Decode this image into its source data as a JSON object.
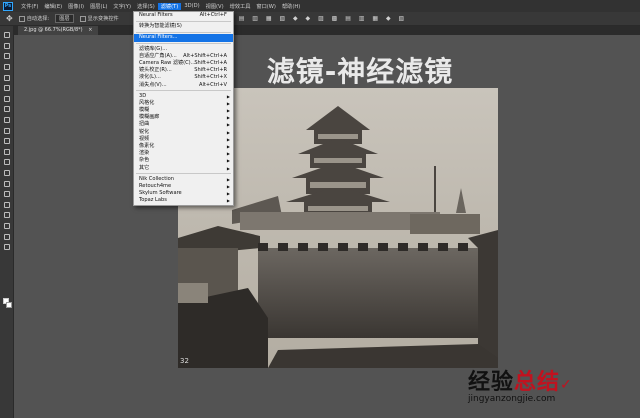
{
  "menubar": {
    "logo": "Ps",
    "items": [
      "文件(F)",
      "编辑(E)",
      "图像(I)",
      "图层(L)",
      "文字(Y)",
      "选择(S)",
      "滤镜(T)",
      "3D(D)",
      "视图(V)",
      "增效工具",
      "窗口(W)",
      "帮助(H)"
    ],
    "active_index": 6
  },
  "options_bar": {
    "auto_select_label": "自动选择:",
    "layer_select": "图层",
    "show_transform_label": "显示变换控件"
  },
  "document_tab": {
    "label": "2.jpg @ 66.7%(RGB/8*)"
  },
  "canvas": {
    "title": "滤镜-神经滤镜",
    "photo_number": "32",
    "watermark_title_1": "经验",
    "watermark_title_2": "总结",
    "watermark_url": "jingyanzongjie.com"
  },
  "filter_menu": {
    "items": [
      {
        "label": "Neural Filters",
        "shortcut": "Alt+Ctrl+F",
        "type": "item"
      },
      {
        "type": "sep"
      },
      {
        "label": "转换为智能滤镜(S)",
        "shortcut": "",
        "type": "item"
      },
      {
        "type": "sep"
      },
      {
        "label": "Neural Filters...",
        "shortcut": "",
        "type": "item",
        "highlight": true
      },
      {
        "type": "sep"
      },
      {
        "label": "滤镜库(G)...",
        "shortcut": "",
        "type": "item"
      },
      {
        "label": "自适应广角(A)...",
        "shortcut": "Alt+Shift+Ctrl+A",
        "type": "item"
      },
      {
        "label": "Camera Raw 滤镜(C)...",
        "shortcut": "Shift+Ctrl+A",
        "type": "item"
      },
      {
        "label": "镜头校正(R)...",
        "shortcut": "Shift+Ctrl+R",
        "type": "item"
      },
      {
        "label": "液化(L)...",
        "shortcut": "Shift+Ctrl+X",
        "type": "item"
      },
      {
        "label": "消失点(V)...",
        "shortcut": "Alt+Ctrl+V",
        "type": "item"
      },
      {
        "type": "sep"
      },
      {
        "label": "3D",
        "type": "sub"
      },
      {
        "label": "风格化",
        "type": "sub"
      },
      {
        "label": "模糊",
        "type": "sub"
      },
      {
        "label": "模糊画廊",
        "type": "sub"
      },
      {
        "label": "扭曲",
        "type": "sub"
      },
      {
        "label": "锐化",
        "type": "sub"
      },
      {
        "label": "视频",
        "type": "sub"
      },
      {
        "label": "像素化",
        "type": "sub"
      },
      {
        "label": "渲染",
        "type": "sub"
      },
      {
        "label": "杂色",
        "type": "sub"
      },
      {
        "label": "其它",
        "type": "sub"
      },
      {
        "type": "sep"
      },
      {
        "label": "Nik Collection",
        "type": "sub"
      },
      {
        "label": "Retouch4me",
        "type": "sub"
      },
      {
        "label": "Skylum Software",
        "type": "sub"
      },
      {
        "label": "Topaz Labs",
        "type": "sub"
      }
    ]
  },
  "colors": {
    "accent": "#1473e6",
    "workspace": "#535353",
    "menubar": "#323232",
    "watermark_red": "#c1121f"
  }
}
